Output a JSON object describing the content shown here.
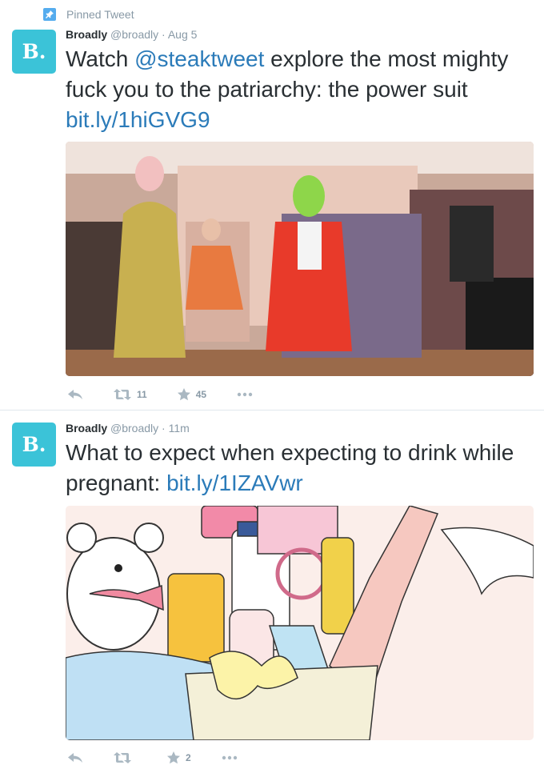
{
  "pinned_label": "Pinned Tweet",
  "tweets": [
    {
      "avatar_letter": "B.",
      "name": "Broadly",
      "handle": "@broadly",
      "separator": "·",
      "time": "Aug 5",
      "text_before": "Watch ",
      "mention": "@steaktweet",
      "text_middle": " explore the most mighty fuck you to the patriarchy: the power suit ",
      "link": "bit.ly/1hiGVG9",
      "retweets": "11",
      "favorites": "45"
    },
    {
      "avatar_letter": "B.",
      "name": "Broadly",
      "handle": "@broadly",
      "separator": "·",
      "time": "11m",
      "text_before": "What to expect when expecting to drink while pregnant: ",
      "link": "bit.ly/1IZAVwr",
      "retweets": "",
      "favorites": "2"
    }
  ],
  "icons": {
    "pin": "pin-icon",
    "reply": "reply-icon",
    "retweet": "retweet-icon",
    "favorite": "star-icon",
    "more": "more-icon"
  },
  "colors": {
    "brand_avatar": "#3bc3d8",
    "link": "#2b7bb9",
    "pin_badge": "#55acee",
    "muted": "#8899a6",
    "action_icon": "#aab8c2"
  }
}
